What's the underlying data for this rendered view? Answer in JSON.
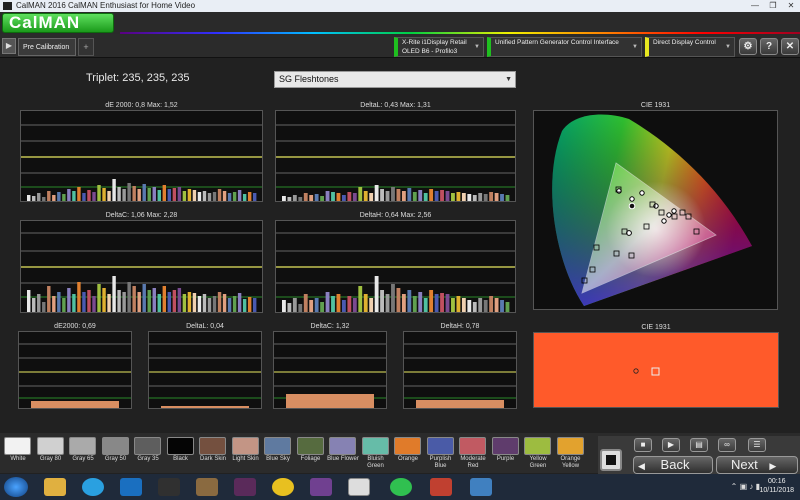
{
  "window": {
    "title": "CalMAN 2016 CalMAN Enthusiast for Home Video",
    "controls": [
      "—",
      "❐",
      "✕"
    ]
  },
  "logo": "CalMAN",
  "tabs": {
    "active": "Pre Calibration",
    "add": "+"
  },
  "devices": [
    {
      "line1": "X-Rite i1Display Retail",
      "line2": "OLED B6 - Profilo3",
      "color": "#1fbf1f"
    },
    {
      "line1": "Unified Pattern Generator Control Interface",
      "line2": "",
      "color": "#1fbf1f"
    },
    {
      "line1": "Direct Display Control",
      "line2": "",
      "color": "#e8e820"
    }
  ],
  "toolbar_icons": [
    "gear-icon",
    "help-icon",
    "close-icon"
  ],
  "triplet": "Triplet: 235, 235, 235",
  "preset": {
    "value": "SG Fleshtones"
  },
  "panels": {
    "p1": "dE 2000: 0,8  Max: 1,52",
    "p2": "DeltaL: 0,43  Max: 1,31",
    "p3": "DeltaC: 1,06  Max: 2,28",
    "p4": "DeltaH: 0,64  Max: 2,56",
    "s1": "dE2000: 0,69",
    "s2": "DeltaL: 0,04",
    "s3": "DeltaC: 1,32",
    "s4": "DeltaH: 0,78",
    "cie_big": "CIE 1931",
    "cie_small": "CIE 1931"
  },
  "swatches": [
    {
      "label": "White",
      "color": "#f2f2f2"
    },
    {
      "label": "Gray 80",
      "color": "#d0d0d0"
    },
    {
      "label": "Gray 65",
      "color": "#aaaaaa"
    },
    {
      "label": "Gray 50",
      "color": "#888888"
    },
    {
      "label": "Gray 35",
      "color": "#5e5e5e"
    },
    {
      "label": "Black",
      "color": "#050505"
    },
    {
      "label": "Dark Skin",
      "color": "#74503f"
    },
    {
      "label": "Light Skin",
      "color": "#c39585"
    },
    {
      "label": "Blue Sky",
      "color": "#5f7aa0"
    },
    {
      "label": "Foliage",
      "color": "#566b3f"
    },
    {
      "label": "Blue Flower",
      "color": "#8682b3"
    },
    {
      "label": "Bluish Green",
      "color": "#66bca8"
    },
    {
      "label": "Orange",
      "color": "#e07b2a"
    },
    {
      "label": "Purplish Blue",
      "color": "#4a5ba7"
    },
    {
      "label": "Moderate Red",
      "color": "#c15a62"
    },
    {
      "label": "Purple",
      "color": "#5f3c6c"
    },
    {
      "label": "Yellow Green",
      "color": "#9dbc40"
    },
    {
      "label": "Orange Yellow",
      "color": "#e2a22e"
    }
  ],
  "nav": {
    "back": "Back",
    "next": "Next"
  },
  "taskbar": {
    "time": "00:16",
    "date": "10/11/2018"
  }
}
